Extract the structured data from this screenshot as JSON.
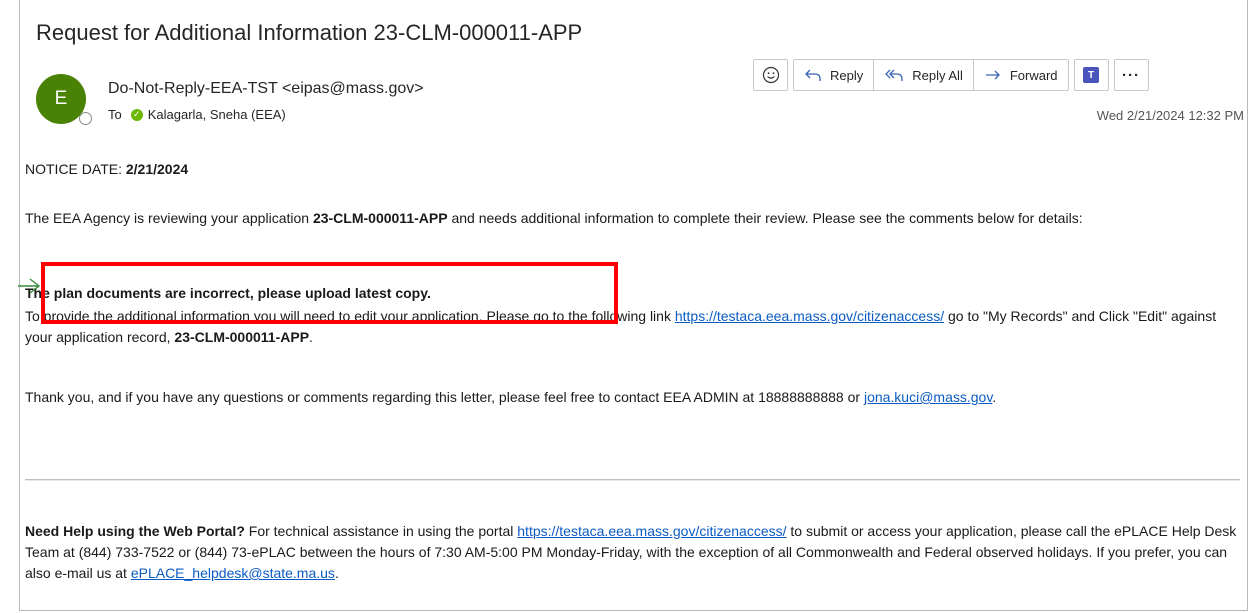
{
  "email": {
    "subject": "Request for Additional Information 23-CLM-000011-APP",
    "avatar_initial": "E",
    "sender": "Do-Not-Reply-EEA-TST <eipas@mass.gov>",
    "to_label": "To",
    "recipient": "Kalagarla, Sneha (EEA)",
    "timestamp": "Wed 2/21/2024 12:32 PM",
    "avatar_color": "#498205"
  },
  "toolbar": {
    "emoji_icon": "smiley-icon",
    "reply_label": "Reply",
    "reply_all_label": "Reply All",
    "forward_label": "Forward",
    "teams_icon": "teams-icon",
    "more_label": "···"
  },
  "body": {
    "notice_label": "NOTICE DATE: ",
    "notice_date": "2/21/2024",
    "p1_a": "The EEA Agency is reviewing your application ",
    "p1_b": "23-CLM-000011-APP",
    "p1_c": " and needs additional information to complete their review. Please see the comments below for details:",
    "comment": "The plan documents are incorrect, please upload latest copy.",
    "p3_a": "To provide the additional information you will need to edit your application. Please go to the following link ",
    "p3_link": "https://testaca.eea.mass.gov/citizenaccess/",
    "p3_b": " go to \"My Records\" and Click \"Edit\" against your application record, ",
    "p3_c": " 23-CLM-000011-APP",
    "p3_d": ".",
    "p4_a": "Thank you, and if you have any questions or comments regarding this letter, please feel free to contact EEA ADMIN at 18888888888 or ",
    "p4_link": "jona.kuci@mass.gov",
    "p4_b": ".",
    "help_bold": "Need Help using the Web Portal?",
    "help_a": " For technical assistance in using the portal ",
    "help_link": "https://testaca.eea.mass.gov/citizenaccess/",
    "help_b": " to submit or access your application,  please call the ePLACE Help Desk Team at (844) 733-7522 or (844) 73-ePLAC between the hours of 7:30 AM-5:00 PM Monday-Friday, with the exception of all Commonwealth and Federal observed holidays. If you prefer, you can also e-mail us at ",
    "help_email": "ePLACE_helpdesk@state.ma.us",
    "help_c": "."
  },
  "annotation": {
    "highlight_color": "#ff0000",
    "arrow_color": "#3a8a3a"
  }
}
